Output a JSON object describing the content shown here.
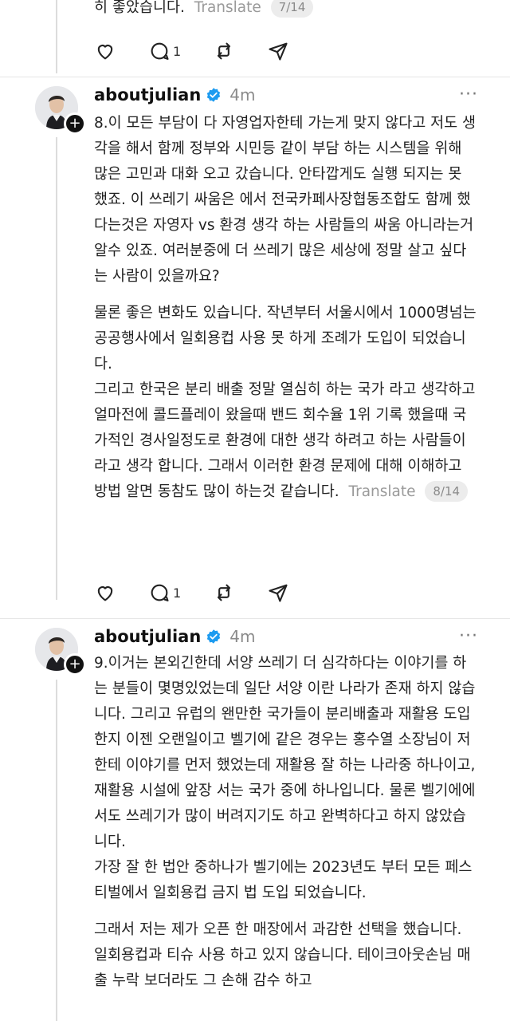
{
  "top_post": {
    "text_tail": "히 좋았습니다.",
    "translate_label": "Translate",
    "page_indicator": "7/14",
    "reply_count": "1"
  },
  "posts": [
    {
      "username": "aboutjulian",
      "time": "4m",
      "paragraphs": [
        "8.이 모든 부담이 다 자영업자한테 가는게 맞지 않다고 저도 생각을 해서 함께 정부와 시민등 같이 부담 하는 시스템을 위해 많은 고민과 대화 오고 갔습니다. 안타깝게도 실행 되지는 못 했죠. 이 쓰레기 싸움은 에서 전국카페사장협동조합도 함께 했다는것은 자영자 vs 환경 생각 하는 사람들의 싸움 아니라는거 알수 있죠. 여러분중에 더 쓰레기 많은 세상에 정말 살고 싶다는 사람이 있을까요?",
        "물론 좋은 변화도 있습니다. 작년부터 서울시에서 1000명넘는 공공행사에서 일회용컵 사용 못 하게 조례가 도입이 되었습니다.",
        "그리고 한국은 분리 배출 정말 열심히 하는 국가 라고 생각하고 얼마전에 콜드플레이 왔을때 밴드 회수율 1위 기록 했을때 국가적인 경사일정도로 환경에 대한 생각 하려고 하는 사람들이라고 생각 합니다. 그래서 이러한 환경 문제에 대해 이해하고 방법 알면 동참도 많이 하는것 같습니다."
      ],
      "translate_label": "Translate",
      "page_indicator": "8/14",
      "reply_count": "1"
    },
    {
      "username": "aboutjulian",
      "time": "4m",
      "paragraphs": [
        "9.이거는 본외긴한데 서양 쓰레기 더 심각하다는 이야기를 하는 분들이 몇명있었는데 일단 서양 이란 나라가 존재 하지 않습니다. 그리고 유럽의 왠만한 국가들이 분리배출과 재활용 도입한지 이젠 오랜일이고 벨기에 같은 경우는 홍수열 소장님이 저한테 이야기를 먼저 했었는데 재활용 잘 하는 나라중 하나이고, 재활용 시설에 앞장 서는 국가 중에 하나입니다. 물론 벨기에에서도 쓰레기가 많이 버려지기도 하고 완벽하다고 하지 않았습니다.",
        "가장 잘 한 법안 중하나가 벨기에는 2023년도 부터 모든 페스티벌에서 일회용컵 금지 법 도입 되었습니다.",
        "그래서 저는 제가 오픈 한 매장에서 과감한 선택을 했습니다. 일회용컵과 티슈 사용 하고 있지 않습니다. 테이크아웃손님 매출 누락 보더라도 그 손해 감수 하고"
      ]
    }
  ],
  "icons": {
    "like": "heart-icon",
    "reply": "comment-icon",
    "repost": "repost-icon",
    "share": "send-icon",
    "verified": "verified-badge-icon",
    "more": "more-icon"
  },
  "colors": {
    "verified": "#1d9bf0",
    "muted": "#8a8a8a",
    "text": "#222222"
  }
}
